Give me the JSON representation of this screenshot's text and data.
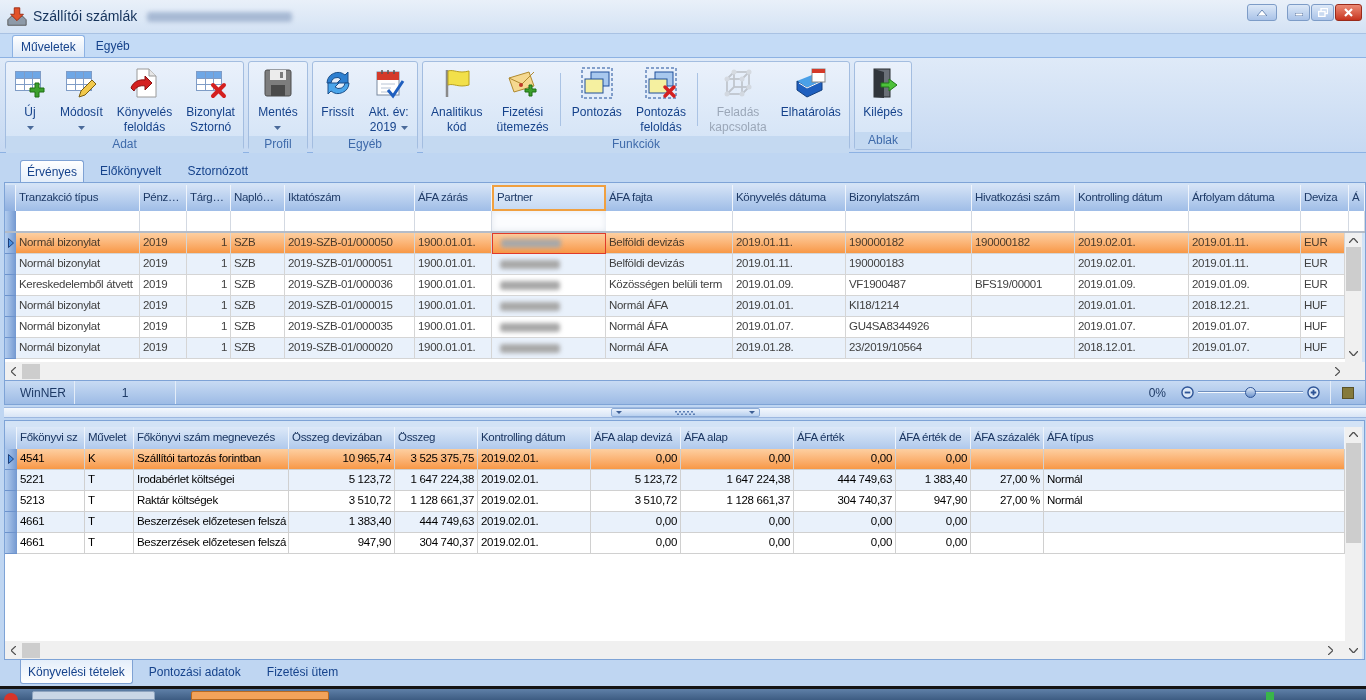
{
  "window": {
    "title": "Szállítói számlák",
    "title_suffix_blurred": true
  },
  "ribbon": {
    "tabs": [
      {
        "label": "Műveletek",
        "selected": true
      },
      {
        "label": "Egyéb",
        "selected": false
      }
    ],
    "groups": [
      {
        "label": "Adat",
        "sections": [
          [
            {
              "label_lines": [
                "Új"
              ],
              "dropdown": true,
              "disabled": false
            },
            {
              "label_lines": [
                "Módosít"
              ],
              "dropdown": true,
              "disabled": false
            },
            {
              "label_lines": [
                "Könyvelés",
                "feloldás"
              ],
              "dropdown": false,
              "disabled": false
            },
            {
              "label_lines": [
                "Bizonylat",
                "Sztornó"
              ],
              "dropdown": false,
              "disabled": false
            }
          ]
        ]
      },
      {
        "label": "Profil",
        "sections": [
          [
            {
              "label_lines": [
                "Mentés"
              ],
              "dropdown": true,
              "disabled": false
            }
          ]
        ]
      },
      {
        "label": "Egyéb",
        "sections": [
          [
            {
              "label_lines": [
                "Frissít"
              ],
              "dropdown": false,
              "disabled": false
            },
            {
              "label_lines": [
                "Akt. év:",
                "2019"
              ],
              "dropdown": true,
              "disabled": false
            }
          ]
        ]
      },
      {
        "label": "Funkciók",
        "sections": [
          [
            {
              "label_lines": [
                "Analitikus",
                "kód"
              ],
              "dropdown": false,
              "disabled": false
            },
            {
              "label_lines": [
                "Fizetési",
                "ütemezés"
              ],
              "dropdown": false,
              "disabled": false
            }
          ],
          [
            {
              "label_lines": [
                "Pontozás"
              ],
              "dropdown": false,
              "disabled": false
            },
            {
              "label_lines": [
                "Pontozás",
                "feloldás"
              ],
              "dropdown": false,
              "disabled": false
            }
          ],
          [
            {
              "label_lines": [
                "Feladás",
                "kapcsolata"
              ],
              "dropdown": false,
              "disabled": true
            },
            {
              "label_lines": [
                "Elhatárolás"
              ],
              "dropdown": false,
              "disabled": false
            }
          ]
        ]
      },
      {
        "label": "Ablak",
        "sections": [
          [
            {
              "label_lines": [
                "Kilépés"
              ],
              "dropdown": false,
              "disabled": false
            }
          ]
        ]
      }
    ]
  },
  "document_tabs": [
    {
      "label": "Érvényes",
      "selected": true
    },
    {
      "label": "Előkönyvelt",
      "selected": false
    },
    {
      "label": "Sztornózott",
      "selected": false
    }
  ],
  "top_grid": {
    "columns": [
      {
        "label": "Tranzakció típus",
        "focused": false,
        "redacted": false
      },
      {
        "label": "Pénz…",
        "focused": false,
        "redacted": false
      },
      {
        "label": "Tárg…",
        "focused": false,
        "redacted": false
      },
      {
        "label": "Napló…",
        "focused": false,
        "redacted": false
      },
      {
        "label": "Iktatószám",
        "focused": false,
        "redacted": false
      },
      {
        "label": "ÁFA zárás",
        "focused": false,
        "redacted": false
      },
      {
        "label": "Partner",
        "focused": true,
        "redacted": true
      },
      {
        "label": "ÁFA fajta",
        "focused": false,
        "redacted": false
      },
      {
        "label": "Könyvelés dátuma",
        "focused": false,
        "redacted": false
      },
      {
        "label": "Bizonylatszám",
        "focused": false,
        "redacted": false
      },
      {
        "label": "Hivatkozási szám",
        "focused": false,
        "redacted": false
      },
      {
        "label": "Kontrolling dátum",
        "focused": false,
        "redacted": false
      },
      {
        "label": "Árfolyam dátuma",
        "focused": false,
        "redacted": false
      },
      {
        "label": "Deviza",
        "focused": false,
        "redacted": false
      },
      {
        "label": "Á",
        "focused": false,
        "redacted": false
      }
    ],
    "rows": [
      {
        "selected": true,
        "cells": [
          "Normál bizonylat",
          "2019",
          "1",
          "SZB",
          "2019-SZB-01/000050",
          "1900.01.01.",
          "",
          "Belföldi devizás",
          "2019.01.11.",
          "190000182",
          "190000182",
          "2019.02.01.",
          "2019.01.11.",
          "EUR"
        ]
      },
      {
        "selected": false,
        "cells": [
          "Normál bizonylat",
          "2019",
          "1",
          "SZB",
          "2019-SZB-01/000051",
          "1900.01.01.",
          "",
          "Belföldi devizás",
          "2019.01.11.",
          "190000183",
          "",
          "2019.02.01.",
          "2019.01.11.",
          "EUR"
        ]
      },
      {
        "selected": false,
        "cells": [
          "Kereskedelemből átvett",
          "2019",
          "1",
          "SZB",
          "2019-SZB-01/000036",
          "1900.01.01.",
          "",
          "Közösségen belüli term",
          "2019.01.09.",
          "VF1900487",
          "BFS19/00001",
          "2019.01.09.",
          "2019.01.09.",
          "EUR"
        ]
      },
      {
        "selected": false,
        "cells": [
          "Normál bizonylat",
          "2019",
          "1",
          "SZB",
          "2019-SZB-01/000015",
          "1900.01.01.",
          "",
          "Normál ÁFA",
          "2019.01.01.",
          "KI18/1214",
          "",
          "2019.01.01.",
          "2018.12.21.",
          "HUF"
        ]
      },
      {
        "selected": false,
        "cells": [
          "Normál bizonylat",
          "2019",
          "1",
          "SZB",
          "2019-SZB-01/000035",
          "1900.01.01.",
          "",
          "Normál ÁFA",
          "2019.01.07.",
          "GU4SA8344926",
          "",
          "2019.01.07.",
          "2019.01.07.",
          "HUF"
        ]
      },
      {
        "selected": false,
        "cells": [
          "Normál bizonylat",
          "2019",
          "1",
          "SZB",
          "2019-SZB-01/000020",
          "1900.01.01.",
          "",
          "Normál ÁFA",
          "2019.01.28.",
          "23/2019/10564",
          "",
          "2018.12.01.",
          "2019.01.07.",
          "HUF"
        ]
      }
    ],
    "status_bar": {
      "cells": [
        "WinNER",
        "1"
      ],
      "zoom": {
        "reading": "0%",
        "level": 0.5
      }
    }
  },
  "bottom_grid": {
    "columns": [
      {
        "label": "Főkönyvi sz"
      },
      {
        "label": "Művelet"
      },
      {
        "label": "Főkönyvi szám megnevezés"
      },
      {
        "label": "Összeg devizában"
      },
      {
        "label": "Összeg"
      },
      {
        "label": "Kontrolling dátum"
      },
      {
        "label": "ÁFA alap devizá"
      },
      {
        "label": "ÁFA alap"
      },
      {
        "label": "ÁFA érték"
      },
      {
        "label": "ÁFA érték de"
      },
      {
        "label": "ÁFA százalék"
      },
      {
        "label": "ÁFA típus"
      }
    ],
    "rows": [
      {
        "selected": true,
        "cells": [
          "4541",
          "K",
          "Szállítói tartozás forintban",
          "10 965,74",
          "3 525 375,75",
          "2019.02.01.",
          "0,00",
          "0,00",
          "0,00",
          "0,00",
          "",
          ""
        ]
      },
      {
        "selected": false,
        "cells": [
          "5221",
          "T",
          "Irodabérlet költségei",
          "5 123,72",
          "1 647 224,38",
          "2019.02.01.",
          "5 123,72",
          "1 647 224,38",
          "444 749,63",
          "1 383,40",
          "27,00 %",
          "Normál"
        ]
      },
      {
        "selected": false,
        "cells": [
          "5213",
          "T",
          "Raktár költségek",
          "3 510,72",
          "1 128 661,37",
          "2019.02.01.",
          "3 510,72",
          "1 128 661,37",
          "304 740,37",
          "947,90",
          "27,00 %",
          "Normál"
        ]
      },
      {
        "selected": false,
        "cells": [
          "4661",
          "T",
          "Beszerzések előzetesen felszá",
          "1 383,40",
          "444 749,63",
          "2019.02.01.",
          "0,00",
          "0,00",
          "0,00",
          "0,00",
          "",
          ""
        ]
      },
      {
        "selected": false,
        "cells": [
          "4661",
          "T",
          "Beszerzések előzetesen felszá",
          "947,90",
          "304 740,37",
          "2019.02.01.",
          "0,00",
          "0,00",
          "0,00",
          "0,00",
          "",
          ""
        ]
      }
    ]
  },
  "bottom_tabs": [
    {
      "label": "Könyvelési tételek",
      "selected": true
    },
    {
      "label": "Pontozási adatok",
      "selected": false
    },
    {
      "label": "Fizetési ütem",
      "selected": false
    }
  ]
}
